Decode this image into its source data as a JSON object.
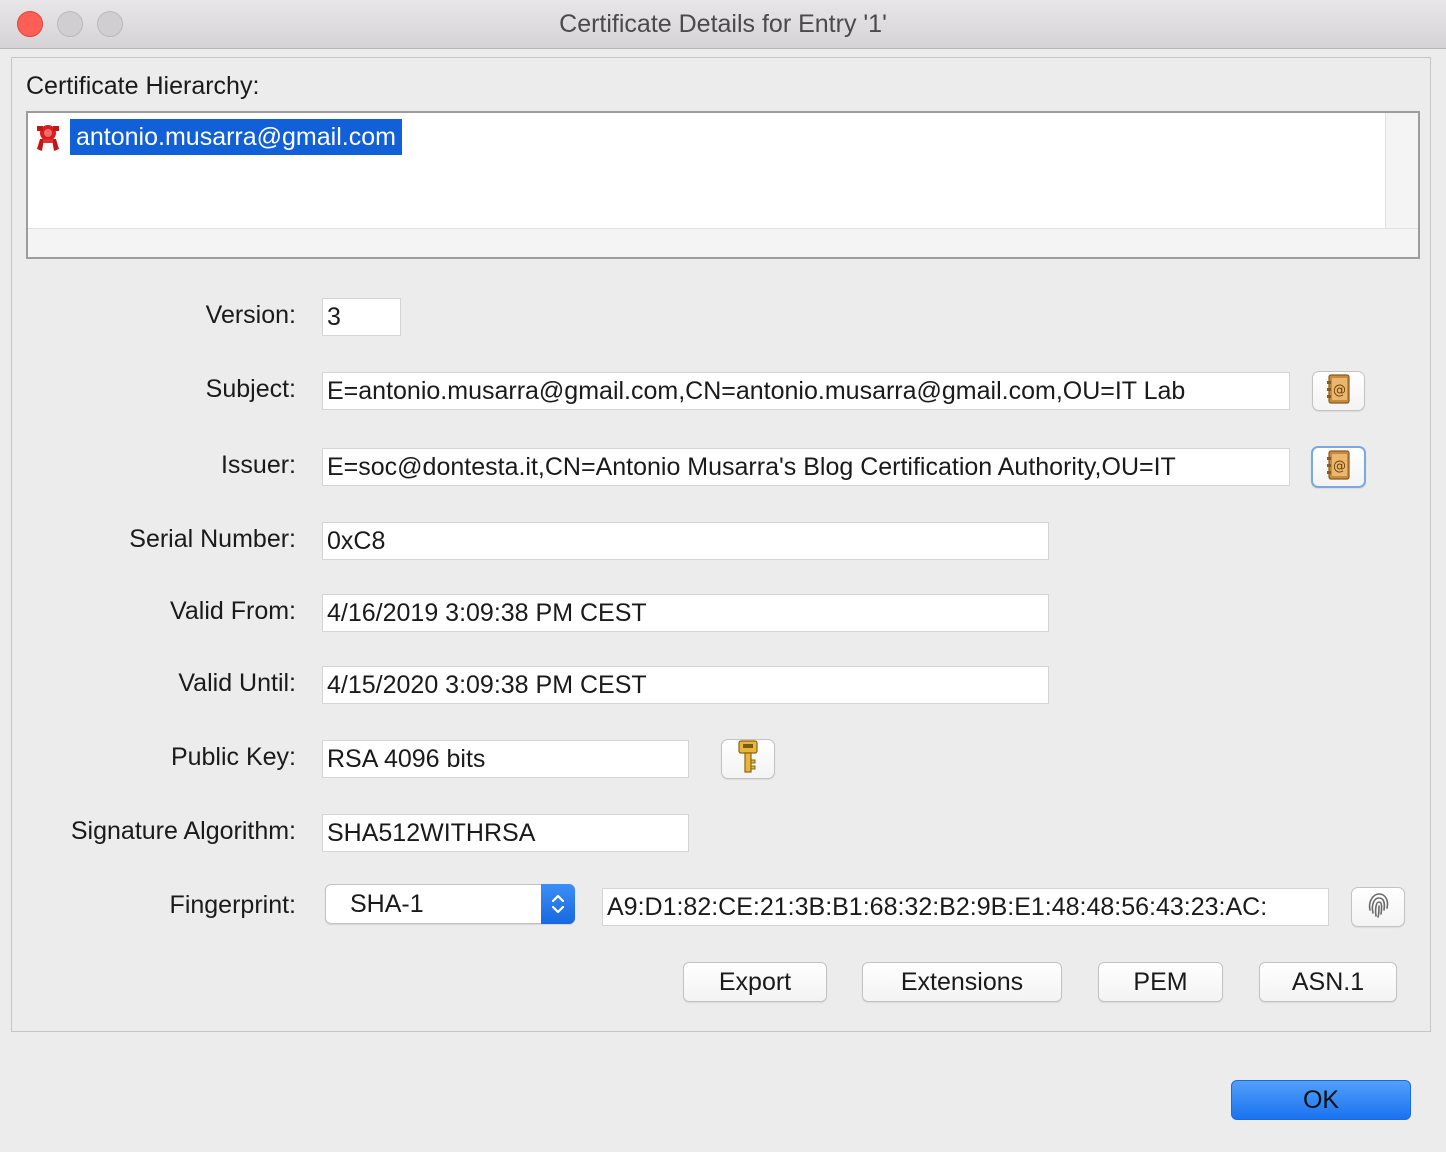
{
  "window": {
    "title": "Certificate Details for Entry '1'"
  },
  "hierarchy": {
    "label": "Certificate Hierarchy:",
    "items": [
      {
        "label": "antonio.musarra@gmail.com",
        "icon": "certificate-icon",
        "selected": true
      }
    ]
  },
  "fields": {
    "version": {
      "label": "Version:",
      "value": "3"
    },
    "subject": {
      "label": "Subject:",
      "value": "E=antonio.musarra@gmail.com,CN=antonio.musarra@gmail.com,OU=IT Lab"
    },
    "issuer": {
      "label": "Issuer:",
      "value": "E=soc@dontesta.it,CN=Antonio Musarra's Blog Certification Authority,OU=IT"
    },
    "serial": {
      "label": "Serial Number:",
      "value": "0xC8"
    },
    "valid_from": {
      "label": "Valid From:",
      "value": "4/16/2019 3:09:38 PM CEST"
    },
    "valid_until": {
      "label": "Valid Until:",
      "value": "4/15/2020 3:09:38 PM CEST"
    },
    "public_key": {
      "label": "Public Key:",
      "value": "RSA 4096 bits"
    },
    "signature_algorithm": {
      "label": "Signature Algorithm:",
      "value": "SHA512WITHRSA"
    },
    "fingerprint": {
      "label": "Fingerprint:",
      "algorithm": "SHA-1",
      "value": "A9:D1:82:CE:21:3B:B1:68:32:B2:9B:E1:48:48:56:43:23:AC:"
    }
  },
  "icons": {
    "subject_details": "address-book-icon",
    "issuer_details": "address-book-icon",
    "public_key_details": "key-icon",
    "fingerprint_details": "fingerprint-icon",
    "select_arrows": "chevron-up-down-icon"
  },
  "buttons": {
    "export": "Export",
    "extensions": "Extensions",
    "pem": "PEM",
    "asn1": "ASN.1",
    "ok": "OK"
  },
  "colors": {
    "selection": "#1160d8",
    "accent": "#1a72ef",
    "close": "#fd5f57"
  }
}
